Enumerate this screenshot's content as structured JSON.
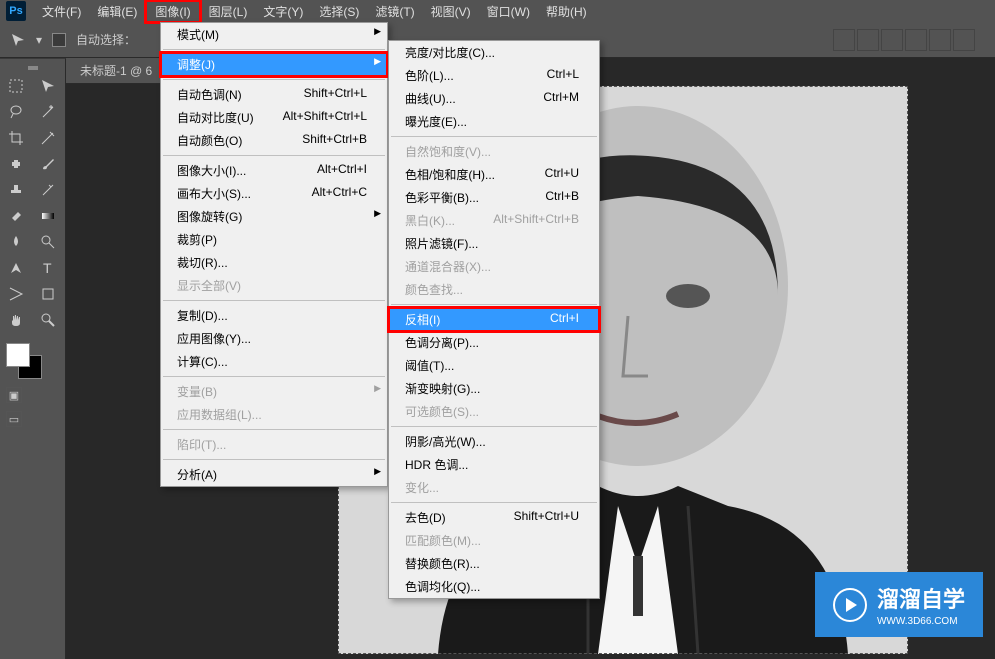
{
  "menubar": {
    "items": [
      "文件(F)",
      "编辑(E)",
      "图像(I)",
      "图层(L)",
      "文字(Y)",
      "选择(S)",
      "滤镜(T)",
      "视图(V)",
      "窗口(W)",
      "帮助(H)"
    ]
  },
  "optionsbar": {
    "auto_select_label": "自动选择："
  },
  "doc_tab": "未标题-1 @ 6",
  "dropdown1": {
    "rows": [
      {
        "label": "模式(M)",
        "shortcut": "",
        "arrow": true
      },
      {
        "sep": true
      },
      {
        "label": "调整(J)",
        "shortcut": "",
        "arrow": true,
        "hovered": true,
        "redbox": true
      },
      {
        "sep": true
      },
      {
        "label": "自动色调(N)",
        "shortcut": "Shift+Ctrl+L"
      },
      {
        "label": "自动对比度(U)",
        "shortcut": "Alt+Shift+Ctrl+L"
      },
      {
        "label": "自动颜色(O)",
        "shortcut": "Shift+Ctrl+B"
      },
      {
        "sep": true
      },
      {
        "label": "图像大小(I)...",
        "shortcut": "Alt+Ctrl+I"
      },
      {
        "label": "画布大小(S)...",
        "shortcut": "Alt+Ctrl+C"
      },
      {
        "label": "图像旋转(G)",
        "shortcut": "",
        "arrow": true
      },
      {
        "label": "裁剪(P)",
        "shortcut": ""
      },
      {
        "label": "裁切(R)...",
        "shortcut": ""
      },
      {
        "label": "显示全部(V)",
        "shortcut": "",
        "disabled": true
      },
      {
        "sep": true
      },
      {
        "label": "复制(D)...",
        "shortcut": ""
      },
      {
        "label": "应用图像(Y)...",
        "shortcut": ""
      },
      {
        "label": "计算(C)...",
        "shortcut": ""
      },
      {
        "sep": true
      },
      {
        "label": "变量(B)",
        "shortcut": "",
        "arrow": true,
        "disabled": true
      },
      {
        "label": "应用数据组(L)...",
        "shortcut": "",
        "disabled": true
      },
      {
        "sep": true
      },
      {
        "label": "陷印(T)...",
        "shortcut": "",
        "disabled": true
      },
      {
        "sep": true
      },
      {
        "label": "分析(A)",
        "shortcut": "",
        "arrow": true
      }
    ]
  },
  "dropdown2": {
    "rows": [
      {
        "label": "亮度/对比度(C)...",
        "shortcut": ""
      },
      {
        "label": "色阶(L)...",
        "shortcut": "Ctrl+L"
      },
      {
        "label": "曲线(U)...",
        "shortcut": "Ctrl+M"
      },
      {
        "label": "曝光度(E)...",
        "shortcut": ""
      },
      {
        "sep": true
      },
      {
        "label": "自然饱和度(V)...",
        "shortcut": "",
        "disabled": true
      },
      {
        "label": "色相/饱和度(H)...",
        "shortcut": "Ctrl+U"
      },
      {
        "label": "色彩平衡(B)...",
        "shortcut": "Ctrl+B"
      },
      {
        "label": "黑白(K)...",
        "shortcut": "Alt+Shift+Ctrl+B",
        "disabled": true
      },
      {
        "label": "照片滤镜(F)...",
        "shortcut": ""
      },
      {
        "label": "通道混合器(X)...",
        "shortcut": "",
        "disabled": true
      },
      {
        "label": "颜色查找...",
        "shortcut": "",
        "disabled": true
      },
      {
        "sep": true
      },
      {
        "label": "反相(I)",
        "shortcut": "Ctrl+I",
        "hovered": true,
        "redbox": true
      },
      {
        "label": "色调分离(P)...",
        "shortcut": ""
      },
      {
        "label": "阈值(T)...",
        "shortcut": ""
      },
      {
        "label": "渐变映射(G)...",
        "shortcut": ""
      },
      {
        "label": "可选颜色(S)...",
        "shortcut": "",
        "disabled": true
      },
      {
        "sep": true
      },
      {
        "label": "阴影/高光(W)...",
        "shortcut": ""
      },
      {
        "label": "HDR 色调...",
        "shortcut": ""
      },
      {
        "label": "变化...",
        "shortcut": "",
        "disabled": true
      },
      {
        "sep": true
      },
      {
        "label": "去色(D)",
        "shortcut": "Shift+Ctrl+U"
      },
      {
        "label": "匹配颜色(M)...",
        "shortcut": "",
        "disabled": true
      },
      {
        "label": "替换颜色(R)...",
        "shortcut": ""
      },
      {
        "label": "色调均化(Q)...",
        "shortcut": ""
      }
    ]
  },
  "watermark": {
    "text": "溜溜自学",
    "url": "WWW.3D66.COM"
  }
}
